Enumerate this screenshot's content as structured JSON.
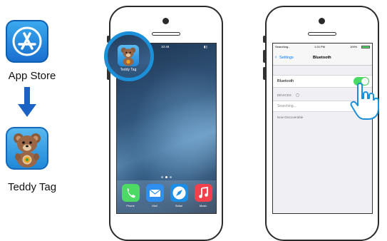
{
  "steps": {
    "app_store": {
      "label": "App Store",
      "icon": "app-store-icon"
    },
    "teddy_tag": {
      "label": "Teddy Tag",
      "icon": "teddy-bear-icon"
    }
  },
  "home_screen": {
    "time": "10:48",
    "app_label": "Teddy Tag",
    "dock": {
      "phone": "Phone",
      "mail": "Mail",
      "safari": "Safari",
      "music": "Music"
    }
  },
  "settings_screen": {
    "status": {
      "carrier": "Searching...",
      "time": "1:24 PM",
      "battery": "100%"
    },
    "back_label": "Settings",
    "title": "Bluetooth",
    "bluetooth_row": "Bluetooth",
    "bluetooth_on": true,
    "devices_header": "DEVICES",
    "searching": "Searching...",
    "discoverable": "Now Discoverable"
  },
  "colors": {
    "accent": "#1b8fd8",
    "toggle_on": "#4cd964",
    "arrow": "#1a62c4"
  }
}
